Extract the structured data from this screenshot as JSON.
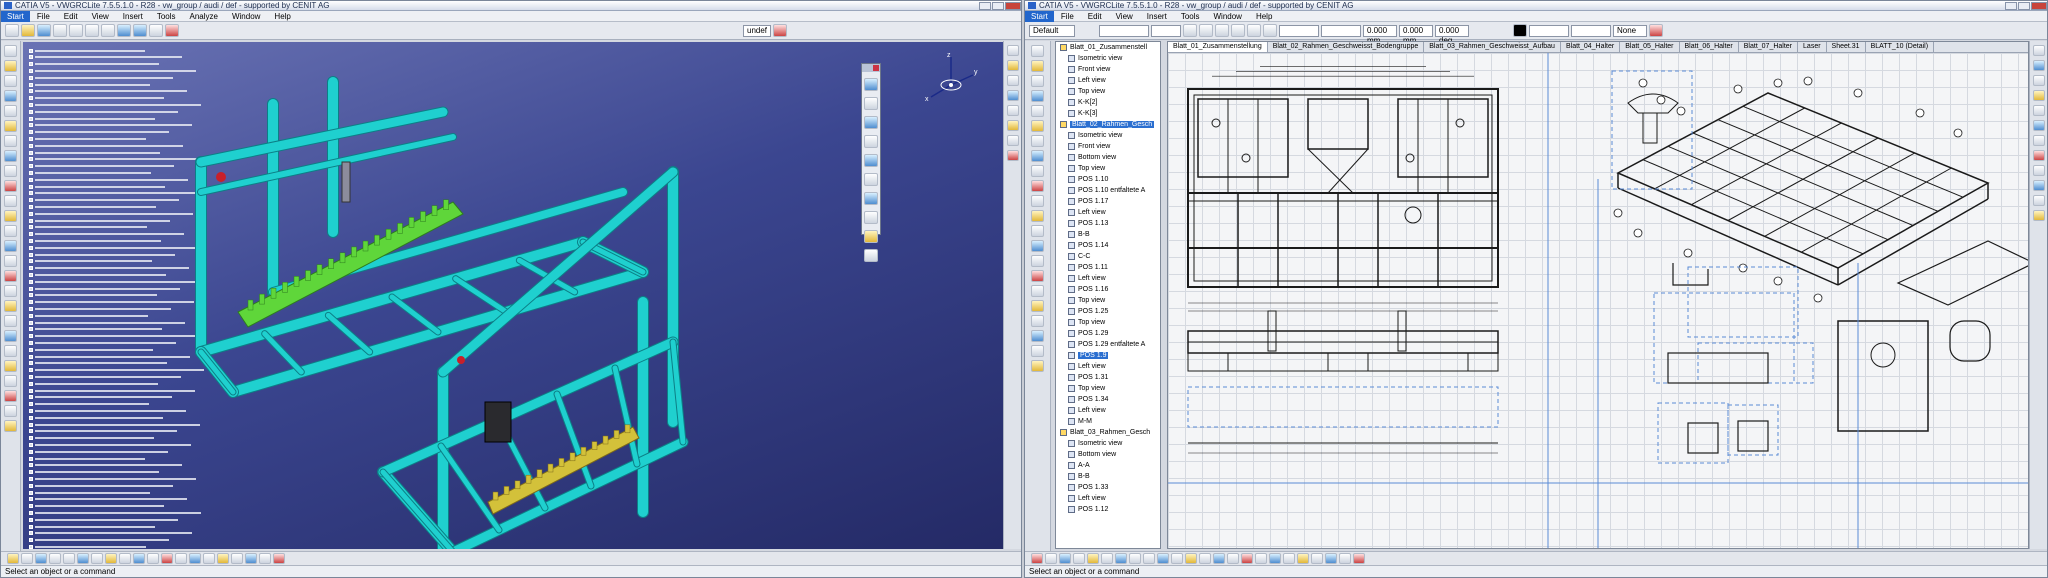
{
  "left_window": {
    "title": "CATIA V5 - VWGRCLite 7.5.5.1.0 - R28 - vw_group / audi / def - supported by CENIT AG",
    "menu": [
      "Start",
      "File",
      "Edit",
      "View",
      "Insert",
      "Tools",
      "Analyze",
      "Window",
      "Help"
    ],
    "layer_value": "undef",
    "status": "Select an object or a command"
  },
  "right_window": {
    "title": "CATIA V5 - VWGRCLite 7.5.5.1.0 - R28 - vw_group / audi / def - supported by CENIT AG",
    "menu": [
      "Start",
      "File",
      "Edit",
      "View",
      "Insert",
      "Tools",
      "Window",
      "Help"
    ],
    "style_value": "Default",
    "dim_value": "0.000 mm",
    "dim_value2": "0.000 mm",
    "angle_value": "0.000 deg",
    "none_value": "None",
    "status": "Select an object or a command",
    "sheet_tabs": [
      "Blatt_01_Zusammenstellung",
      "Blatt_02_Rahmen_Geschweisst_Bodengruppe",
      "Blatt_03_Rahmen_Geschweisst_Aufbau",
      "Blatt_04_Halter",
      "Blatt_05_Halter",
      "Blatt_06_Halter",
      "Blatt_07_Halter",
      "Laser",
      "Sheet.31",
      "BLATT_10 (Detail)"
    ],
    "tree": [
      {
        "label": "Blatt_01_Zusammenstell",
        "type": "sheet"
      },
      {
        "label": "Isometric view",
        "type": "view"
      },
      {
        "label": "Front view",
        "type": "view"
      },
      {
        "label": "Left view",
        "type": "view"
      },
      {
        "label": "Top view",
        "type": "view"
      },
      {
        "label": "K-K[2]",
        "type": "view"
      },
      {
        "label": "K-K[3]",
        "type": "view"
      },
      {
        "label": "Blatt_02_Rahmen_Gesch",
        "type": "sheet",
        "selected": true
      },
      {
        "label": "Isometric view",
        "type": "view"
      },
      {
        "label": "Front view",
        "type": "view"
      },
      {
        "label": "Bottom view",
        "type": "view"
      },
      {
        "label": "Top view",
        "type": "view"
      },
      {
        "label": "POS 1.10",
        "type": "view"
      },
      {
        "label": "POS 1.10 entfaltete A",
        "type": "view"
      },
      {
        "label": "POS 1.17",
        "type": "view"
      },
      {
        "label": "Left view",
        "type": "view"
      },
      {
        "label": "POS 1.13",
        "type": "view"
      },
      {
        "label": "B-B",
        "type": "view"
      },
      {
        "label": "POS 1.14",
        "type": "view"
      },
      {
        "label": "C-C",
        "type": "view"
      },
      {
        "label": "POS 1.11",
        "type": "view"
      },
      {
        "label": "Left view",
        "type": "view"
      },
      {
        "label": "POS 1.16",
        "type": "view"
      },
      {
        "label": "Top view",
        "type": "view"
      },
      {
        "label": "POS 1.25",
        "type": "view"
      },
      {
        "label": "Top view",
        "type": "view"
      },
      {
        "label": "POS 1.29",
        "type": "view"
      },
      {
        "label": "POS 1.29 entfaltete A",
        "type": "view"
      },
      {
        "label": "POS 1.9",
        "type": "view",
        "selected": true
      },
      {
        "label": "Left view",
        "type": "view"
      },
      {
        "label": "POS 1.31",
        "type": "view"
      },
      {
        "label": "Top view",
        "type": "view"
      },
      {
        "label": "POS 1.34",
        "type": "view"
      },
      {
        "label": "Left view",
        "type": "view"
      },
      {
        "label": "M-M",
        "type": "view"
      },
      {
        "label": "Blatt_03_Rahmen_Gesch",
        "type": "sheet"
      },
      {
        "label": "Isometric view",
        "type": "view"
      },
      {
        "label": "Bottom view",
        "type": "view"
      },
      {
        "label": "A-A",
        "type": "view"
      },
      {
        "label": "B-B",
        "type": "view"
      },
      {
        "label": "POS 1.33",
        "type": "view"
      },
      {
        "label": "Left view",
        "type": "view"
      },
      {
        "label": "POS 1.12",
        "type": "view"
      }
    ]
  },
  "colors": {
    "frame": "#1fd0cf",
    "frame_dark": "#0c7f86",
    "green_part": "#5fd63a",
    "yellow_part": "#d3c13a",
    "bg_top": "#6a73b4",
    "bg_bottom": "#242a66"
  },
  "icons": [
    "save-icon",
    "open-icon",
    "undo-icon",
    "redo-icon",
    "compass-icon",
    "zoom-icon",
    "pan-icon",
    "rotate-icon"
  ]
}
